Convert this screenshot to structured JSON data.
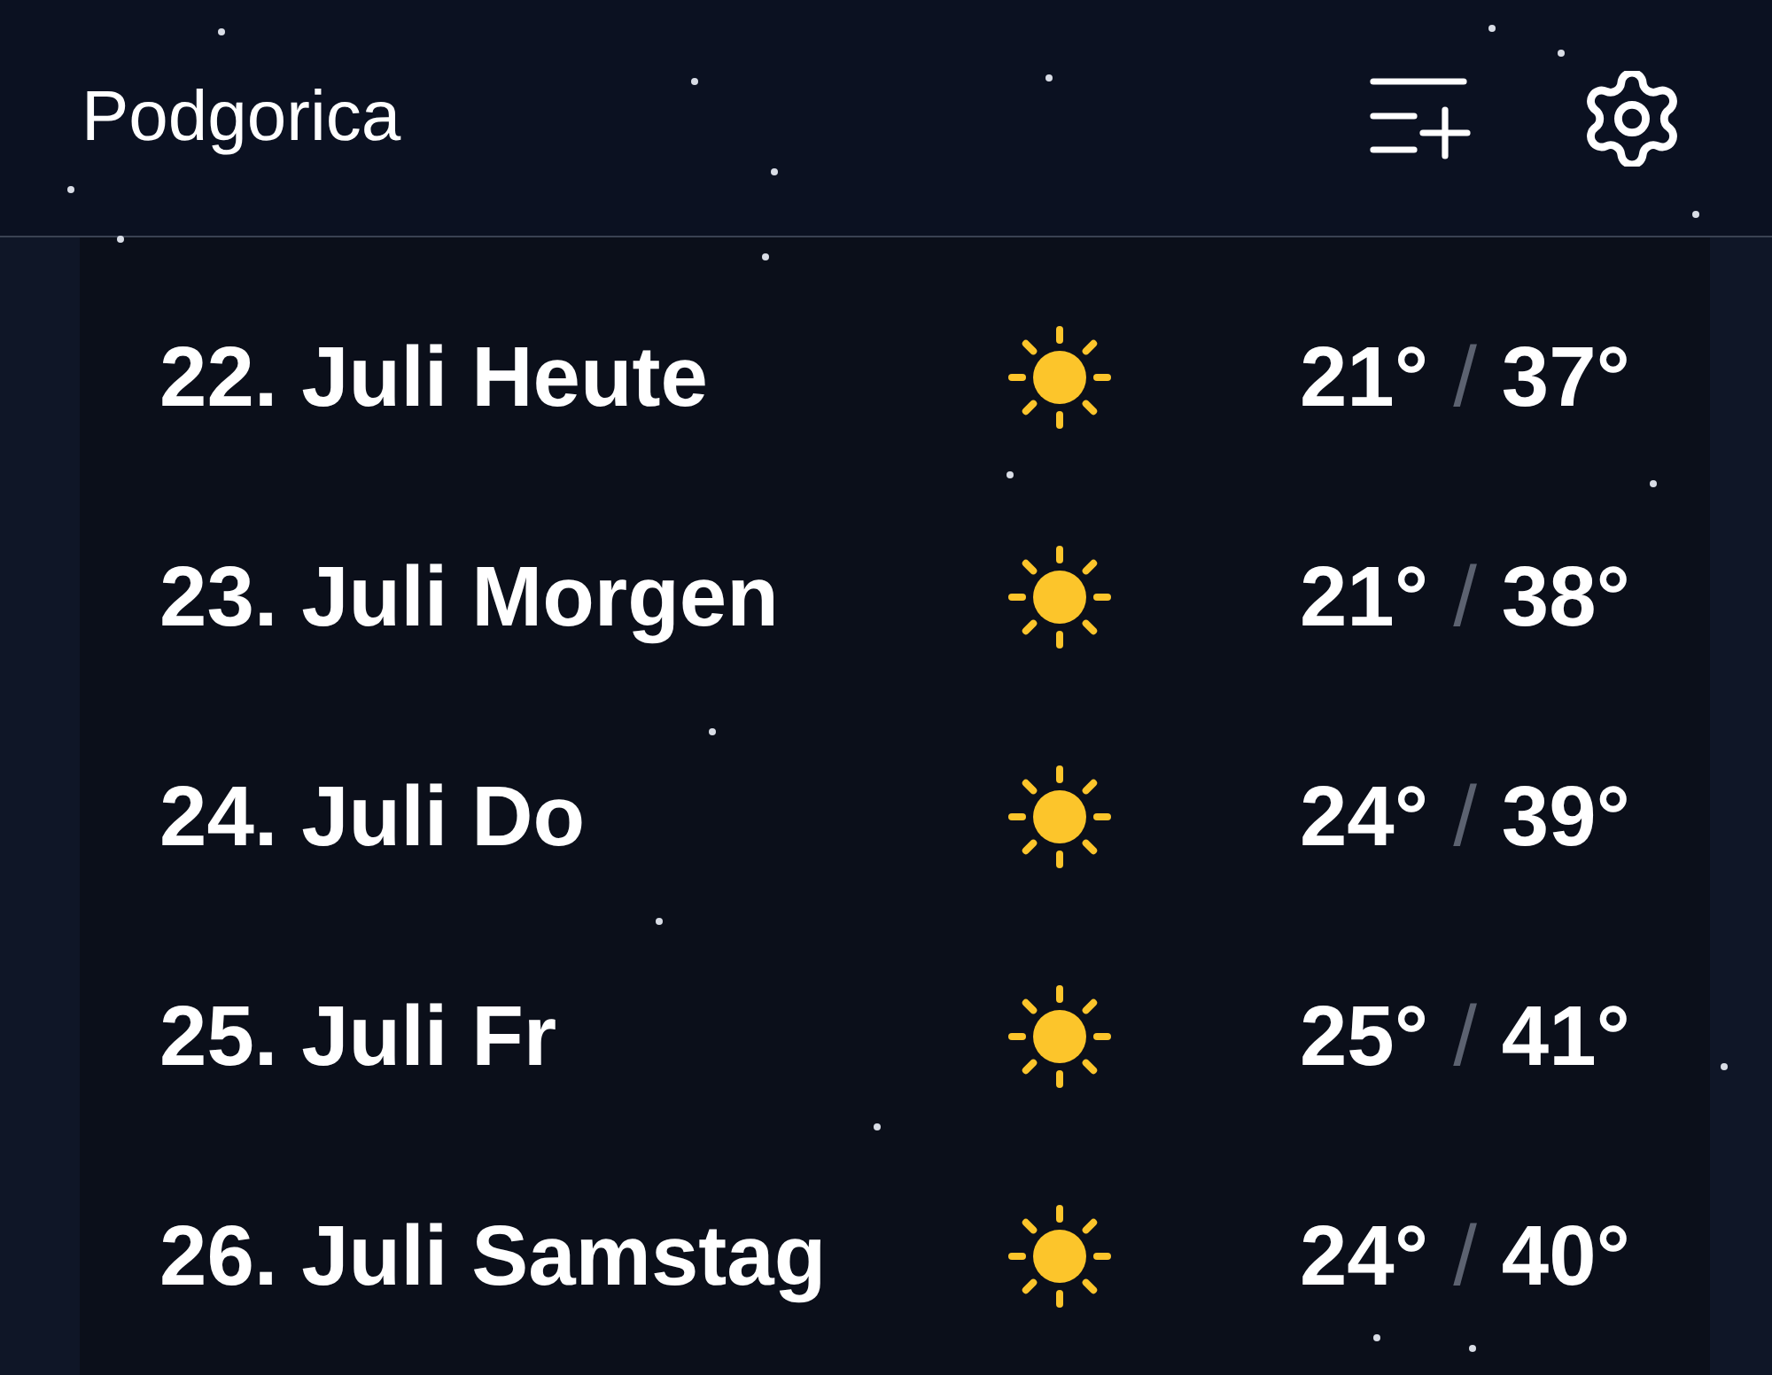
{
  "header": {
    "title": "Podgorica"
  },
  "forecast": [
    {
      "label": "22. Juli Heute",
      "kind": "sunny",
      "low": "21°",
      "separator": "/",
      "high": "37°"
    },
    {
      "label": "23. Juli Morgen",
      "kind": "sunny",
      "low": "21°",
      "separator": "/",
      "high": "38°"
    },
    {
      "label": "24. Juli Do",
      "kind": "sunny",
      "low": "24°",
      "separator": "/",
      "high": "39°"
    },
    {
      "label": "25. Juli Fr",
      "kind": "sunny",
      "low": "25°",
      "separator": "/",
      "high": "41°"
    },
    {
      "label": "26. Juli Samstag",
      "kind": "sunny",
      "low": "24°",
      "separator": "/",
      "high": "40°"
    }
  ]
}
